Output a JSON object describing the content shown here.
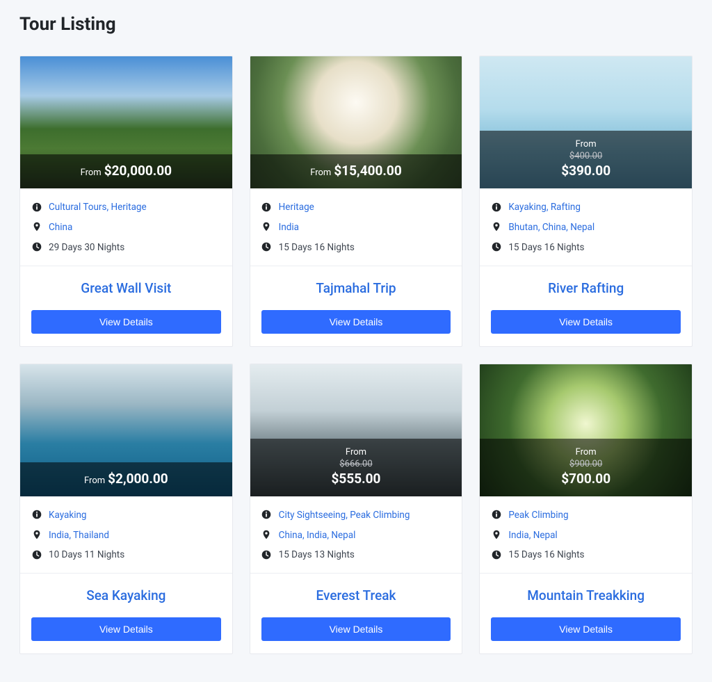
{
  "page_title": "Tour Listing",
  "from_label": "From",
  "view_details_label": "View Details",
  "tours": [
    {
      "title": "Great Wall Visit",
      "price": "$20,000.00",
      "old_price": null,
      "price_layout": "inline",
      "categories": [
        "Cultural Tours",
        "Heritage"
      ],
      "locations": [
        "China"
      ],
      "duration": "29 Days 30 Nights",
      "bg": "bg-0"
    },
    {
      "title": "Tajmahal Trip",
      "price": "$15,400.00",
      "old_price": null,
      "price_layout": "inline",
      "categories": [
        "Heritage"
      ],
      "locations": [
        "India"
      ],
      "duration": "15 Days 16 Nights",
      "bg": "bg-1"
    },
    {
      "title": "River Rafting",
      "price": "$390.00",
      "old_price": "$400.00",
      "price_layout": "stacked",
      "categories": [
        "Kayaking",
        "Rafting"
      ],
      "locations": [
        "Bhutan",
        "China",
        "Nepal"
      ],
      "duration": "15 Days 16 Nights",
      "bg": "bg-2"
    },
    {
      "title": "Sea Kayaking",
      "price": "$2,000.00",
      "old_price": null,
      "price_layout": "inline",
      "categories": [
        "Kayaking"
      ],
      "locations": [
        "India",
        "Thailand"
      ],
      "duration": "10 Days 11 Nights",
      "bg": "bg-3"
    },
    {
      "title": "Everest Treak",
      "price": "$555.00",
      "old_price": "$666.00",
      "price_layout": "stacked",
      "categories": [
        "City Sightseeing",
        "Peak Climbing"
      ],
      "locations": [
        "China",
        "India",
        "Nepal"
      ],
      "duration": "15 Days 13 Nights",
      "bg": "bg-4"
    },
    {
      "title": "Mountain Treakking",
      "price": "$700.00",
      "old_price": "$900.00",
      "price_layout": "stacked",
      "categories": [
        "Peak Climbing"
      ],
      "locations": [
        "India",
        "Nepal"
      ],
      "duration": "15 Days 16 Nights",
      "bg": "bg-5"
    }
  ]
}
